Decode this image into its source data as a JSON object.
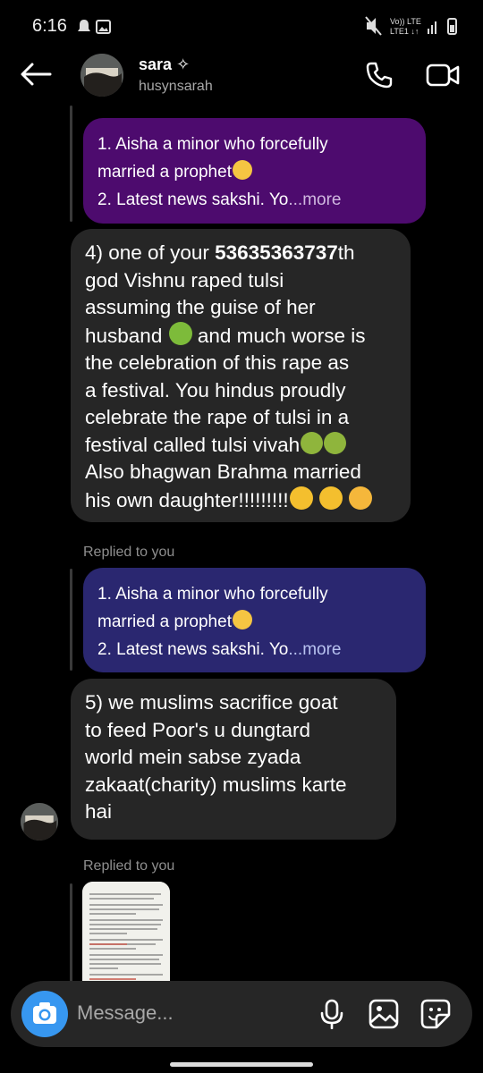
{
  "status_bar": {
    "time": "6:16",
    "network_top": "Vo)) LTE",
    "network_bottom": "LTE1 ↓↑"
  },
  "header": {
    "name": "sara",
    "handle": "husynsarah"
  },
  "messages": {
    "reply1": {
      "line1": "1. Aisha a minor who forcefully",
      "line2": "married a prophet",
      "line3": "2. Latest news sakshi. Yo",
      "more": "...more"
    },
    "msg4": {
      "prefix": "4) one of your ",
      "bold": "53635363737",
      "after_bold": "th",
      "lines": [
        "god Vishnu raped tulsi",
        "assuming the guise of her",
        "husband",
        "and much worse is",
        "the celebration of this rape as",
        "a festival. You hindus proudly",
        "celebrate the rape of tulsi in a",
        "festival called tulsi vivah",
        "Also bhagwan Brahma married",
        "his own daughter!!!!!!!!!"
      ]
    },
    "replied_label": "Replied to you",
    "reply2": {
      "line1": "1. Aisha a minor who forcefully",
      "line2": "married a prophet",
      "line3": "2. Latest news sakshi. Yo",
      "more": "...more"
    },
    "msg5": {
      "lines": [
        "5) we muslims sacrifice goat",
        "to feed Poor's u dungtard",
        "world mein sabse zyada",
        "zakaat(charity) muslims karte",
        "hai"
      ]
    },
    "replied_label_2": "Replied to you"
  },
  "composer": {
    "placeholder": "Message..."
  },
  "colors": {
    "reply1_bg": "#4d0b6e",
    "reply2_bg": "#2a2770",
    "message_bg": "#262626",
    "camera_bg": "#3797f0"
  }
}
